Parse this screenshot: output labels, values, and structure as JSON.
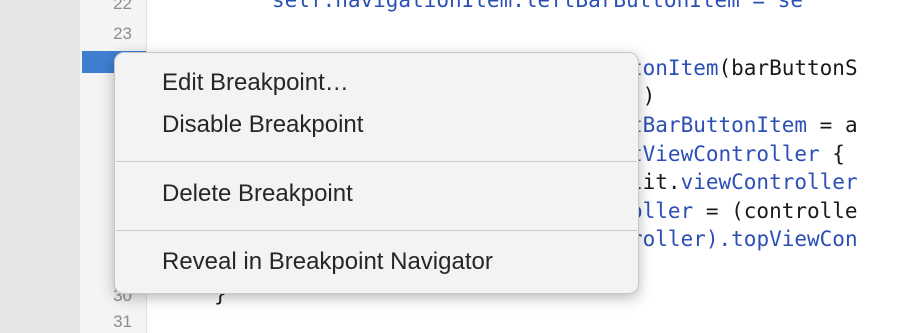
{
  "gutter": {
    "line_numbers": [
      "22",
      "23",
      "30",
      "31"
    ]
  },
  "code": {
    "top_line": {
      "part1": "self.navigationItem.leftBarButtonItem = se"
    },
    "lines_right": [
      {
        "segments": [
          {
            "text": "tonItem",
            "color": "blue"
          },
          {
            "text": "(barButtonS",
            "color": "black"
          }
        ]
      },
      {
        "segments": [
          {
            "text": "))",
            "color": "black"
          }
        ]
      },
      {
        "segments": [
          {
            "text": "tBarButtonItem",
            "color": "blue"
          },
          {
            "text": " = a",
            "color": "black"
          }
        ]
      },
      {
        "segments": [
          {
            "text": "tViewController",
            "color": "blue"
          },
          {
            "text": " { ",
            "color": "black"
          }
        ]
      },
      {
        "segments": [
          {
            "text": "lit.",
            "color": "black"
          },
          {
            "text": "viewController",
            "color": "blue"
          }
        ]
      },
      {
        "segments": [
          {
            "text": "oller",
            "color": "blue"
          },
          {
            "text": " = (controlle",
            "color": "black"
          }
        ]
      },
      {
        "segments": [
          {
            "text": "roller).",
            "color": "blue"
          },
          {
            "text": "topViewCon",
            "color": "blue"
          }
        ]
      }
    ],
    "closing_brace": "}"
  },
  "context_menu": {
    "items": [
      {
        "label": "Edit Breakpoint…"
      },
      {
        "label": "Disable Breakpoint"
      },
      {
        "label": "Delete Breakpoint"
      },
      {
        "label": "Reveal in Breakpoint Navigator"
      }
    ]
  },
  "colors": {
    "breakpoint": "#3e7fd1",
    "code_blue": "#2c4fb5",
    "menu_bg": "#f3f3f3"
  }
}
